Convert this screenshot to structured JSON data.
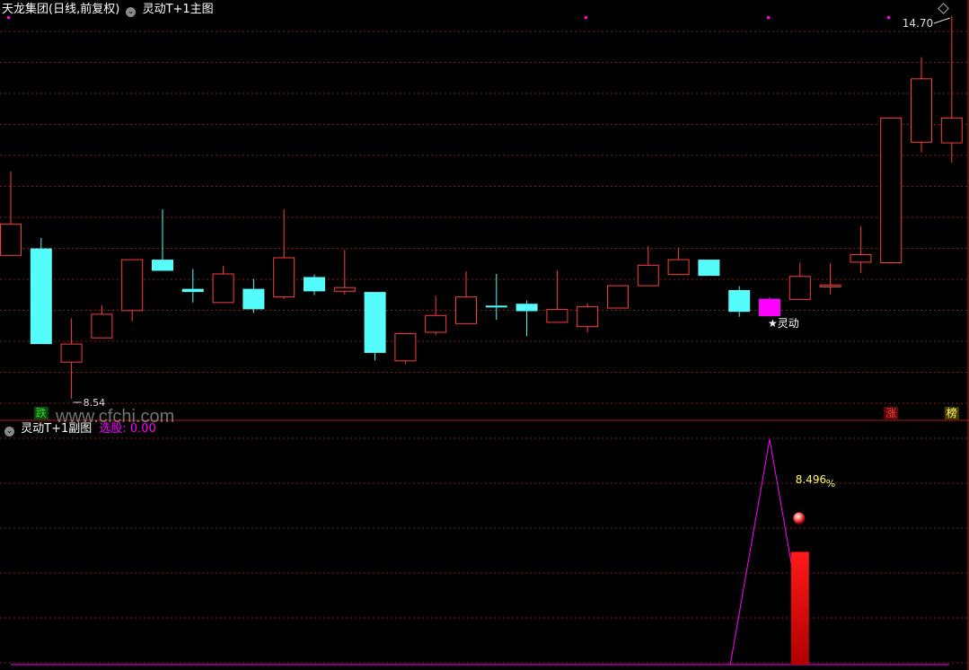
{
  "main_header": {
    "stock": "天龙集团(日线,前复权)",
    "indicator": "灵动T+1主图",
    "dropdown_icon": "chevron-down-icon"
  },
  "sub_header": {
    "indicator": "灵动T+1副图",
    "label": "选股: 0.00"
  },
  "watermark": "www.cfchi.com",
  "colors": {
    "up": "#ff3b3b",
    "down": "#54fcfc",
    "signal": "#ff00ff",
    "grid": "#8b1a1a",
    "label_white": "#ffffff",
    "label_yellow": "#ffff55"
  },
  "chart_data": {
    "type": "candlestick",
    "price_max": 14.7,
    "price_min": 8.54,
    "max_label": "14.70",
    "min_label": "8.54",
    "signal_label": "★灵动",
    "candles": [
      {
        "o": 10.85,
        "c": 11.35,
        "h": 12.2,
        "l": 10.85
      },
      {
        "o": 10.96,
        "c": 9.42,
        "h": 11.13,
        "l": 9.42
      },
      {
        "o": 9.13,
        "c": 9.42,
        "h": 9.83,
        "l": 8.54
      },
      {
        "o": 9.52,
        "c": 9.9,
        "h": 10.05,
        "l": 9.52
      },
      {
        "o": 9.96,
        "c": 10.78,
        "h": 10.78,
        "l": 9.79
      },
      {
        "o": 10.78,
        "c": 10.6,
        "h": 11.59,
        "l": 10.6
      },
      {
        "o": 10.31,
        "c": 10.26,
        "h": 10.63,
        "l": 10.09
      },
      {
        "o": 10.09,
        "c": 10.55,
        "h": 10.68,
        "l": 10.09
      },
      {
        "o": 10.31,
        "c": 9.98,
        "h": 10.47,
        "l": 9.92
      },
      {
        "o": 10.18,
        "c": 10.81,
        "h": 11.59,
        "l": 10.15
      },
      {
        "o": 10.5,
        "c": 10.27,
        "h": 10.54,
        "l": 10.21
      },
      {
        "o": 10.27,
        "c": 10.33,
        "h": 10.94,
        "l": 10.22
      },
      {
        "o": 10.26,
        "c": 9.28,
        "h": 10.26,
        "l": 9.16
      },
      {
        "o": 9.15,
        "c": 9.59,
        "h": 9.59,
        "l": 9.1
      },
      {
        "o": 9.61,
        "c": 9.88,
        "h": 10.2,
        "l": 9.57
      },
      {
        "o": 9.75,
        "c": 10.18,
        "h": 10.59,
        "l": 9.75
      },
      {
        "o": 10.04,
        "c": 10.02,
        "h": 10.55,
        "l": 9.81
      },
      {
        "o": 10.07,
        "c": 9.95,
        "h": 10.12,
        "l": 9.55
      },
      {
        "o": 9.77,
        "c": 9.98,
        "h": 10.61,
        "l": 9.77
      },
      {
        "o": 9.7,
        "c": 10.02,
        "h": 10.08,
        "l": 9.61
      },
      {
        "o": 10.0,
        "c": 10.36,
        "h": 10.36,
        "l": 10.0
      },
      {
        "o": 10.36,
        "c": 10.69,
        "h": 11.0,
        "l": 10.36
      },
      {
        "o": 10.54,
        "c": 10.78,
        "h": 10.97,
        "l": 10.54
      },
      {
        "o": 10.78,
        "c": 10.52,
        "h": 10.78,
        "l": 10.52
      },
      {
        "o": 10.29,
        "c": 9.94,
        "h": 10.35,
        "l": 9.86
      },
      {
        "o": 9.87,
        "c": 10.15,
        "h": 10.18,
        "l": 9.87
      },
      {
        "o": 10.14,
        "c": 10.51,
        "h": 10.73,
        "l": 10.14
      },
      {
        "o": 10.34,
        "c": 10.37,
        "h": 10.72,
        "l": 10.22
      },
      {
        "o": 10.74,
        "c": 10.86,
        "h": 11.32,
        "l": 10.57
      },
      {
        "o": 10.73,
        "c": 13.06,
        "h": 13.06,
        "l": 10.73
      },
      {
        "o": 12.67,
        "c": 13.69,
        "h": 14.04,
        "l": 12.51
      },
      {
        "o": 12.66,
        "c": 13.06,
        "h": 14.7,
        "l": 12.34
      }
    ],
    "signal_candle_index": 25,
    "markers": [
      {
        "index": 1,
        "text": "跌",
        "color": "#35d935"
      },
      {
        "index": 29,
        "text": "涨",
        "color": "#ff3b3b"
      },
      {
        "index": 31,
        "text": "榜",
        "color": "#ffff55"
      }
    ],
    "sub_chart": {
      "peak_label": "8.496",
      "peak_label_suffix": "%",
      "triangle_start_index": 24,
      "triangle_peak_index": 25,
      "triangle_end_index": 26,
      "peak_value": 1.0,
      "bar_index": 26,
      "bar_value": 0.5
    }
  }
}
